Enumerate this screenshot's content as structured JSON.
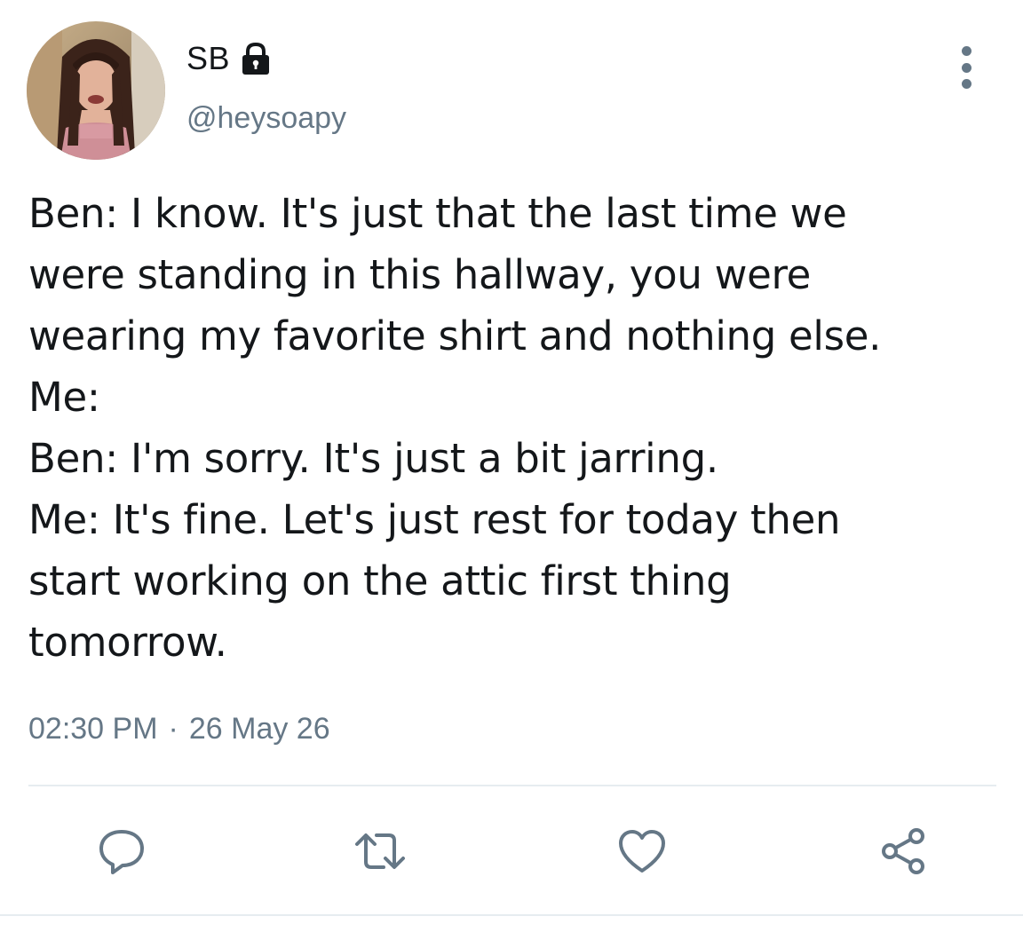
{
  "user": {
    "display_name": "SB",
    "handle": "@heysoapy",
    "protected_icon": "lock-icon",
    "avatar_icon": "avatar-photo"
  },
  "tweet": {
    "lines": [
      "Ben: I know. It's just that the last time we",
      "were standing in this hallway, you were",
      "wearing my favorite shirt and nothing else.",
      "Me:",
      "Ben: I'm sorry. It's just a bit jarring.",
      "Me: It's fine. Let's just rest for today then",
      "start working on the attic first thing",
      "tomorrow."
    ],
    "time": "02:30 PM",
    "separator": "·",
    "date": "26 May 26"
  },
  "actions": {
    "reply_icon": "reply-icon",
    "retweet_icon": "retweet-icon",
    "like_icon": "heart-icon",
    "share_icon": "share-icon"
  },
  "colors": {
    "text": "#14171a",
    "secondary": "#657786",
    "divider": "#e6ecf0"
  }
}
